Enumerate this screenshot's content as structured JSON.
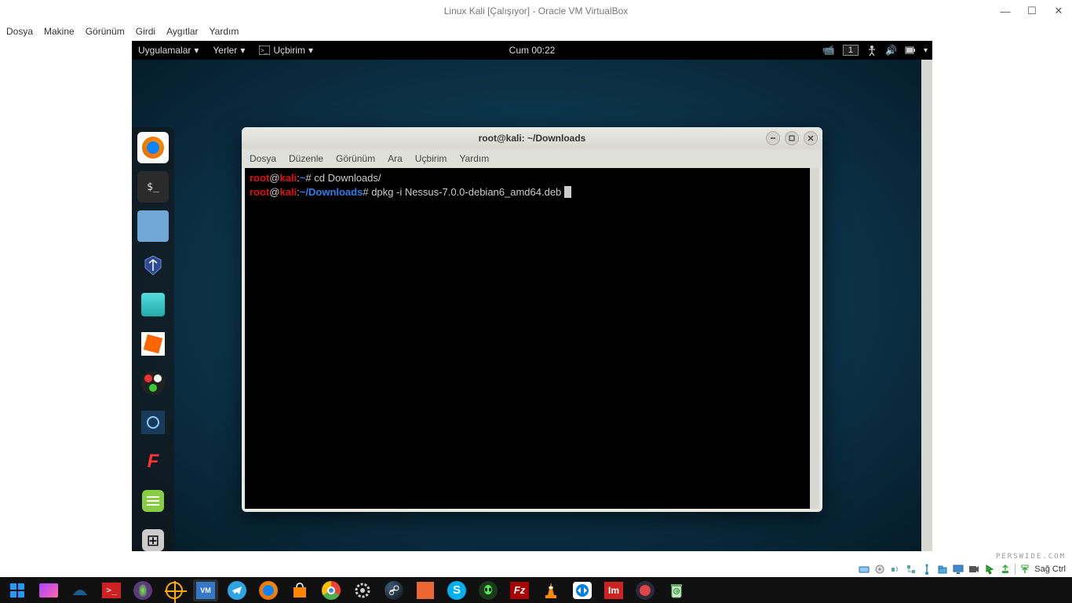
{
  "virtualbox": {
    "title": "Linux Kali [Çalışıyor] - Oracle VM VirtualBox",
    "menu": [
      "Dosya",
      "Makine",
      "Görünüm",
      "Girdi",
      "Aygıtlar",
      "Yardım"
    ],
    "host_key": "Sağ Ctrl"
  },
  "kali_topbar": {
    "apps": "Uygulamalar",
    "places": "Yerler",
    "app_indicator": "Uçbirim",
    "clock": "Cum 00:22",
    "workspace": "1"
  },
  "dock_icons": [
    "firefox",
    "terminal",
    "files",
    "metasploit",
    "armitage",
    "burp",
    "recorder",
    "zenmap",
    "faraday",
    "leafpad",
    "tweaks"
  ],
  "terminal": {
    "title": "root@kali: ~/Downloads",
    "menu": [
      "Dosya",
      "Düzenle",
      "Görünüm",
      "Ara",
      "Uçbirim",
      "Yardım"
    ],
    "lines": [
      {
        "user": "root",
        "at": "@",
        "host": "kali",
        "sep": ":",
        "path": "~",
        "prompt": "# ",
        "cmd": "cd Downloads/"
      },
      {
        "user": "root",
        "at": "@",
        "host": "kali",
        "sep": ":",
        "path": "~/Downloads",
        "prompt": "# ",
        "cmd": "dpkg -i Nessus-7.0.0-debian6_amd64.deb "
      }
    ]
  },
  "taskbar_icons": [
    "start",
    "taskview",
    "wireshark",
    "terminal",
    "tor",
    "target",
    "virtualbox",
    "telegram",
    "firefox",
    "store",
    "chrome",
    "settings",
    "steam",
    "app",
    "skype",
    "alien",
    "filezilla",
    "vlc",
    "teamviewer",
    "im",
    "app2",
    "trash"
  ],
  "watermark": "PERSWIDE.COM"
}
